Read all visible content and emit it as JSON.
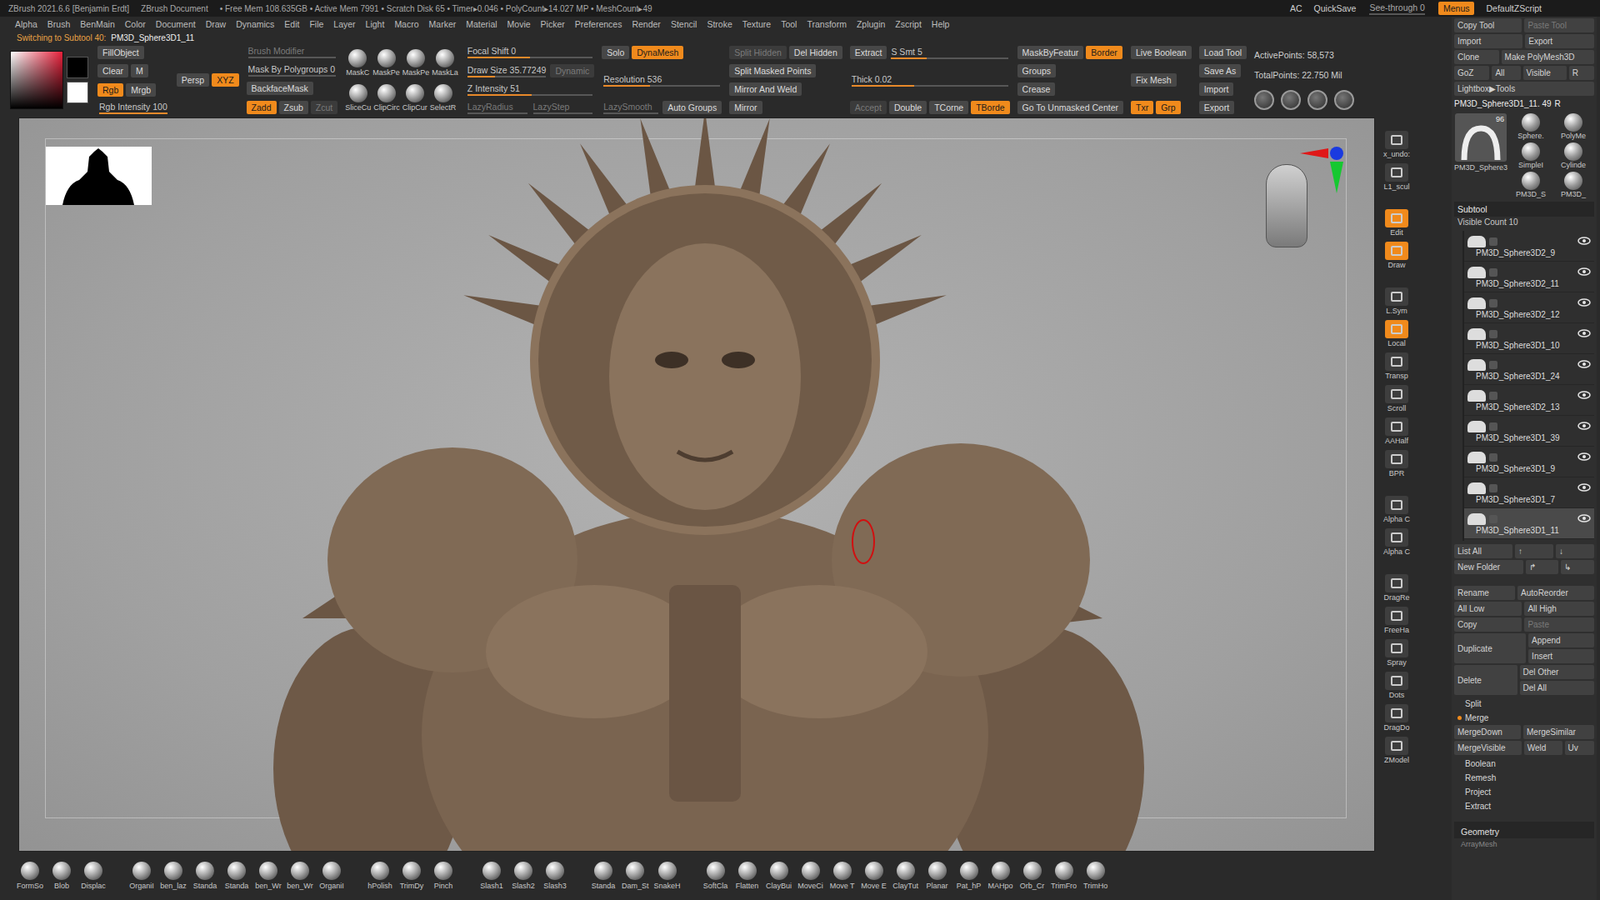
{
  "title_bar": {
    "app": "ZBrush 2021.6.6 [Benjamin Erdt]",
    "document": "ZBrush Document",
    "stats": "• Free Mem 108.635GB • Active Mem 7991 • Scratch Disk 65 • Timer▸0.046 • PolyCount▸14.027 MP • MeshCount▸49",
    "right": [
      {
        "label": "AC",
        "kind": "text"
      },
      {
        "label": "QuickSave",
        "kind": "text"
      },
      {
        "label": "See-through   0",
        "kind": "slider",
        "level": 0,
        "disabled": false
      },
      {
        "label": "Menus",
        "kind": "button",
        "selected": true,
        "disabled": false
      },
      {
        "label": "DefaultZScript",
        "kind": "text"
      }
    ]
  },
  "menu": [
    "Alpha",
    "Brush",
    "BenMain",
    "Color",
    "Document",
    "Draw",
    "Dynamics",
    "Edit",
    "File",
    "Layer",
    "Light",
    "Macro",
    "Marker",
    "Material",
    "Movie",
    "Picker",
    "Preferences",
    "Render",
    "Stencil",
    "Stroke",
    "Texture",
    "Tool",
    "Transform",
    "Zplugin",
    "Zscript",
    "Help"
  ],
  "status": {
    "message": "Switching to Subtool 40:",
    "tool": "PM3D_Sphere3D1_11"
  },
  "toolbar": [
    {
      "rows": [
        [
          {
            "label": "FillObject",
            "kind": "button",
            "selected": false,
            "disabled": false
          }
        ],
        [
          {
            "label": "Clear",
            "kind": "button",
            "selected": false,
            "disabled": false
          },
          {
            "label": "M",
            "kind": "button",
            "selected": false,
            "disabled": false
          }
        ],
        [
          {
            "label": "Rgb",
            "kind": "button",
            "selected": true,
            "disabled": false
          },
          {
            "label": "Mrgb",
            "kind": "button",
            "selected": false,
            "disabled": false
          }
        ],
        [
          {
            "label": "Rgb Intensity 100",
            "kind": "slider",
            "level": 1,
            "disabled": false
          }
        ]
      ]
    },
    {
      "rows": [
        [
          {
            "label": "Persp",
            "kind": "button",
            "selected": false,
            "disabled": false
          },
          {
            "label": "XYZ",
            "kind": "button",
            "selected": true,
            "disabled": false
          }
        ]
      ]
    },
    {
      "rows": [
        [
          {
            "label": "Brush Modifier",
            "kind": "slider",
            "level": 0,
            "disabled": true
          }
        ],
        [
          {
            "label": "Mask By Polygroups 0",
            "kind": "slider",
            "level": 0,
            "disabled": false
          }
        ],
        [
          {
            "label": "BackfaceMask",
            "kind": "button",
            "selected": false,
            "disabled": false
          }
        ],
        [
          {
            "label": "Zadd",
            "kind": "button",
            "selected": true,
            "disabled": false
          },
          {
            "label": "Zsub",
            "kind": "button",
            "selected": false,
            "disabled": false
          },
          {
            "label": "Zcut",
            "kind": "button",
            "selected": false,
            "disabled": true
          }
        ]
      ]
    },
    {
      "rows": [
        [
          {
            "label": "MaskC",
            "kind": "icon"
          },
          {
            "label": "MaskPe",
            "kind": "icon"
          },
          {
            "label": "MaskPe",
            "kind": "icon"
          },
          {
            "label": "MaskLa",
            "kind": "icon"
          }
        ],
        [
          {
            "label": "SliceCu",
            "kind": "icon"
          },
          {
            "label": "ClipCirc",
            "kind": "icon"
          },
          {
            "label": "ClipCur",
            "kind": "icon"
          },
          {
            "label": "SelectR",
            "kind": "icon"
          }
        ]
      ]
    },
    {
      "rows": [
        [
          {
            "label": "Focal Shift 0",
            "kind": "slider",
            "level": 0.5,
            "disabled": false
          }
        ],
        [
          {
            "label": "Draw Size 35.77249",
            "kind": "slider",
            "level": 0.35,
            "disabled": false
          },
          {
            "label": "Dynamic",
            "kind": "button",
            "selected": false,
            "disabled": true
          }
        ],
        [
          {
            "label": "Z Intensity 51",
            "kind": "slider",
            "level": 0.51,
            "disabled": false
          }
        ],
        [
          {
            "label": "LazyRadius",
            "kind": "slider",
            "level": 0,
            "disabled": true
          },
          {
            "label": "LazyStep",
            "kind": "slider",
            "level": 0,
            "disabled": true
          }
        ]
      ]
    },
    {
      "rows": [
        [
          {
            "label": "Solo",
            "kind": "button",
            "selected": false,
            "disabled": false
          },
          {
            "label": "DynaMesh",
            "kind": "button",
            "selected": true,
            "disabled": false
          }
        ],
        [
          {
            "label": "Resolution 536",
            "kind": "slider",
            "level": 0.4,
            "disabled": false
          }
        ],
        [
          {
            "label": "LazySmooth",
            "kind": "slider",
            "level": 0,
            "disabled": true
          },
          {
            "label": "Auto Groups",
            "kind": "button",
            "selected": false,
            "disabled": false
          }
        ]
      ]
    },
    {
      "rows": [
        [
          {
            "label": "Split Hidden",
            "kind": "button",
            "selected": false,
            "disabled": true
          },
          {
            "label": "Del Hidden",
            "kind": "button",
            "selected": false,
            "disabled": false
          }
        ],
        [
          {
            "label": "Split Masked Points",
            "kind": "button",
            "selected": false,
            "disabled": false
          }
        ],
        [
          {
            "label": "Mirror And Weld",
            "kind": "button",
            "selected": false,
            "disabled": false
          }
        ],
        [
          {
            "label": "Mirror",
            "kind": "button",
            "selected": false,
            "disabled": false
          }
        ]
      ]
    },
    {
      "rows": [
        [
          {
            "label": "Extract",
            "kind": "button",
            "selected": false,
            "disabled": false
          },
          {
            "label": "S Smt 5",
            "kind": "slider",
            "level": 0.3,
            "disabled": false
          }
        ],
        [
          {
            "label": "Thick 0.02",
            "kind": "slider",
            "level": 0.4,
            "disabled": false
          }
        ],
        [
          {
            "label": "Accept",
            "kind": "button",
            "selected": false,
            "disabled": true
          },
          {
            "label": "Double",
            "kind": "button",
            "selected": false,
            "disabled": false
          },
          {
            "label": "TCorne",
            "kind": "button",
            "selected": false,
            "disabled": false
          },
          {
            "label": "TBorde",
            "kind": "button",
            "selected": true,
            "disabled": false
          }
        ]
      ]
    },
    {
      "rows": [
        [
          {
            "label": "MaskByFeatur",
            "kind": "button",
            "selected": false,
            "disabled": false
          },
          {
            "label": "Border",
            "kind": "button",
            "selected": true,
            "disabled": false
          }
        ],
        [
          {
            "label": "Groups",
            "kind": "button",
            "selected": false,
            "disabled": false
          }
        ],
        [
          {
            "label": "Crease",
            "kind": "button",
            "selected": false,
            "disabled": false
          }
        ],
        [
          {
            "label": "Go To Unmasked Center",
            "kind": "button",
            "selected": false,
            "disabled": false
          }
        ]
      ]
    },
    {
      "rows": [
        [
          {
            "label": "Live Boolean",
            "kind": "button",
            "selected": false,
            "disabled": false
          }
        ],
        [
          {
            "label": "Fix Mesh",
            "kind": "button",
            "selected": false,
            "disabled": false
          }
        ],
        [
          {
            "label": "Txr",
            "kind": "button",
            "selected": true,
            "disabled": false
          },
          {
            "label": "Grp",
            "kind": "button",
            "selected": true,
            "disabled": false
          }
        ]
      ]
    },
    {
      "rows": [
        [
          {
            "label": "Load Tool",
            "kind": "button",
            "selected": false,
            "disabled": false
          }
        ],
        [
          {
            "label": "Save As",
            "kind": "button",
            "selected": false,
            "disabled": false
          }
        ],
        [
          {
            "label": "Import",
            "kind": "button",
            "selected": false,
            "disabled": false
          }
        ],
        [
          {
            "label": "Export",
            "kind": "button",
            "selected": false,
            "disabled": false
          }
        ]
      ]
    },
    {
      "rows": [
        [
          {
            "label": "ActivePoints: 58,573",
            "kind": "text"
          }
        ],
        [
          {
            "label": "TotalPoints: 22.750 Mil",
            "kind": "text"
          }
        ]
      ]
    }
  ],
  "tool_palette": {
    "rows": [
      [
        {
          "label": "Copy Tool",
          "disabled": false
        },
        {
          "label": "Paste Tool",
          "disabled": true
        }
      ],
      [
        {
          "label": "Import",
          "disabled": false
        },
        {
          "label": "Export",
          "disabled": false
        }
      ],
      [
        {
          "label": "Clone",
          "disabled": false
        },
        {
          "label": "Make PolyMesh3D",
          "disabled": false
        }
      ],
      [
        {
          "label": "GoZ",
          "disabled": false
        },
        {
          "label": "All",
          "disabled": false
        },
        {
          "label": "Visible",
          "disabled": false
        },
        {
          "label": "R",
          "disabled": false
        }
      ],
      [
        {
          "label": "Lightbox▶Tools",
          "disabled": false
        }
      ]
    ],
    "current": "PM3D_Sphere3D1_11. 49",
    "current_r": "R",
    "thumbs": {
      "main": {
        "label": "PM3D_Sphere3",
        "count": "96"
      },
      "small": [
        "Sphere.",
        "PolyMe",
        "SimpleI",
        "Cylinde",
        "PM3D_S",
        "PM3D_"
      ]
    }
  },
  "subtool": {
    "title": "Subtool",
    "visible_count": "Visible Count 10",
    "items": [
      {
        "name": "PM3D_Sphere3D2_9",
        "visible": true,
        "selected": false
      },
      {
        "name": "PM3D_Sphere3D2_11",
        "visible": true,
        "selected": false
      },
      {
        "name": "PM3D_Sphere3D2_12",
        "visible": true,
        "selected": false
      },
      {
        "name": "PM3D_Sphere3D1_10",
        "visible": true,
        "selected": false
      },
      {
        "name": "PM3D_Sphere3D1_24",
        "visible": true,
        "selected": false
      },
      {
        "name": "PM3D_Sphere3D2_13",
        "visible": true,
        "selected": false
      },
      {
        "name": "PM3D_Sphere3D1_39",
        "visible": true,
        "selected": false
      },
      {
        "name": "PM3D_Sphere3D1_9",
        "visible": true,
        "selected": false
      },
      {
        "name": "PM3D_Sphere3D1_7",
        "visible": true,
        "selected": false
      },
      {
        "name": "PM3D_Sphere3D1_11",
        "visible": true,
        "selected": true
      }
    ],
    "nav": [
      [
        {
          "label": "List All",
          "disabled": false
        },
        {
          "label": "↑",
          "disabled": false
        },
        {
          "label": "↓",
          "disabled": false
        }
      ],
      [
        {
          "label": "New Folder",
          "disabled": false
        },
        {
          "label": "↱",
          "disabled": false
        },
        {
          "label": "↳",
          "disabled": false
        }
      ]
    ],
    "lower": [
      {
        "kind": "buttons",
        "items": [
          {
            "label": "Rename",
            "disabled": false
          },
          {
            "label": "AutoReorder",
            "disabled": false
          }
        ]
      },
      {
        "kind": "buttons",
        "items": [
          {
            "label": "All Low",
            "disabled": false
          },
          {
            "label": "All High",
            "disabled": false
          }
        ]
      },
      {
        "kind": "buttons",
        "items": [
          {
            "label": "Copy",
            "disabled": false
          },
          {
            "label": "Paste",
            "disabled": true
          }
        ]
      },
      {
        "kind": "buttons",
        "items": [
          {
            "label": "Duplicate",
            "disabled": false
          },
          {
            "stack": [
              {
                "label": "Append",
                "disabled": false
              },
              {
                "label": "Insert",
                "disabled": false
              }
            ]
          }
        ]
      },
      {
        "kind": "buttons",
        "items": [
          {
            "label": "Delete",
            "disabled": false
          },
          {
            "stack": [
              {
                "label": "Del Other",
                "disabled": false
              },
              {
                "label": "Del All",
                "disabled": false
              }
            ]
          }
        ]
      },
      {
        "kind": "section",
        "label": "Split",
        "expanded": false
      },
      {
        "kind": "section",
        "label": "Merge",
        "expanded": true
      },
      {
        "kind": "buttons",
        "items": [
          {
            "label": "MergeDown",
            "disabled": false
          },
          {
            "label": "MergeSimilar",
            "disabled": false
          }
        ]
      },
      {
        "kind": "buttons",
        "items": [
          {
            "label": "MergeVisible",
            "disabled": false
          },
          {
            "label": "Weld",
            "disabled": false
          },
          {
            "label": "Uv",
            "disabled": false
          }
        ]
      },
      {
        "kind": "section",
        "label": "Boolean",
        "expanded": false
      },
      {
        "kind": "section",
        "label": "Remesh",
        "expanded": false
      },
      {
        "kind": "section",
        "label": "Project",
        "expanded": false
      },
      {
        "kind": "section",
        "label": "Extract",
        "expanded": false
      }
    ]
  },
  "geometry": {
    "label": "Geometry",
    "sub": "ArrayMesh"
  },
  "shelf": [
    [
      {
        "label": "x_undo:",
        "selected": false
      },
      {
        "label": "L1_scul",
        "selected": false
      }
    ],
    [
      {
        "label": "Edit",
        "selected": true
      },
      {
        "label": "Draw",
        "selected": true
      }
    ],
    [
      {
        "label": "L.Sym",
        "selected": false
      },
      {
        "label": "Local",
        "selected": true
      },
      {
        "label": "Transp",
        "selected": false
      },
      {
        "label": "Scroll",
        "selected": false
      },
      {
        "label": "AAHalf",
        "selected": false
      },
      {
        "label": "BPR",
        "selected": false
      }
    ],
    [
      {
        "label": "Alpha C",
        "selected": false
      },
      {
        "label": "Alpha C",
        "selected": false
      }
    ],
    [
      {
        "label": "DragRe",
        "selected": false
      },
      {
        "label": "FreeHa",
        "selected": false
      },
      {
        "label": "Spray",
        "selected": false
      },
      {
        "label": "Dots",
        "selected": false
      },
      {
        "label": "DragDo",
        "selected": false
      },
      {
        "label": "ZModel",
        "selected": false
      }
    ]
  ],
  "brushes": [
    [
      "FormSo",
      "Blob",
      "Displac"
    ],
    [
      "OrganiI",
      "ben_laz",
      "Standa",
      "Standa",
      "ben_Wr",
      "ben_Wr",
      "OrganiI"
    ],
    [
      "hPolish",
      "TrimDy",
      "Pinch"
    ],
    [
      "Slash1",
      "Slash2",
      "Slash3"
    ],
    [
      "Standa",
      "Dam_St",
      "SnakeH"
    ],
    [
      "SoftCla",
      "Flatten",
      "ClayBui",
      "MoveCi",
      "Move T",
      "Move E",
      "ClayTut",
      "Planar",
      "Pat_hP",
      "MAHpo",
      "Orb_Cr",
      "TrimFro",
      "TrimHo"
    ]
  ]
}
